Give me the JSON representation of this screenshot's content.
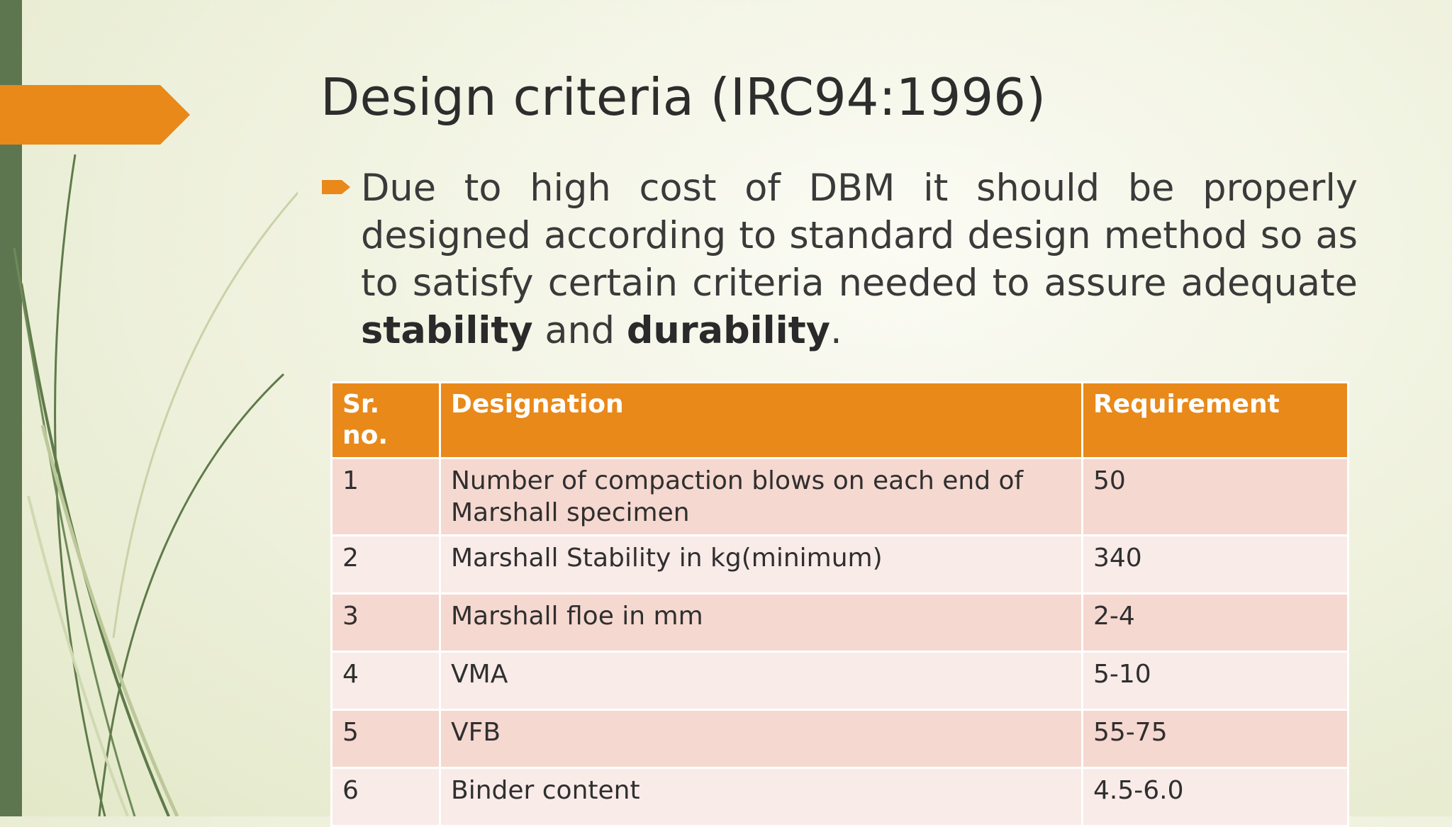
{
  "slide": {
    "title": "Design criteria (IRC94:1996)",
    "paragraph": {
      "text_before": "Due to high cost of DBM it should be properly designed according to standard design method so as to satisfy certain criteria needed to assure adequate ",
      "bold_1": "stability",
      "text_middle": " and ",
      "bold_2": "durability",
      "text_after": "."
    },
    "bullet_icon": "orange-arrow-bullet-icon",
    "colors": {
      "accent_orange": "#e8891a",
      "left_bar_green": "#5e7650",
      "row_odd": "#f5d8d0",
      "row_even": "#f8ebe8"
    }
  },
  "table": {
    "headers": {
      "sr": "Sr. no.",
      "designation": "Designation",
      "requirement": "Requirement"
    },
    "rows": [
      {
        "sr": "1",
        "designation": "Number of compaction blows on each end of Marshall specimen",
        "requirement": "50"
      },
      {
        "sr": "2",
        "designation": "Marshall Stability in kg(minimum)",
        "requirement": "340"
      },
      {
        "sr": "3",
        "designation": "Marshall floe in mm",
        "requirement": "2-4"
      },
      {
        "sr": "4",
        "designation": "VMA",
        "requirement": "5-10"
      },
      {
        "sr": "5",
        "designation": "VFB",
        "requirement": "55-75"
      },
      {
        "sr": "6",
        "designation": "Binder content",
        "requirement": "4.5-6.0"
      }
    ]
  }
}
